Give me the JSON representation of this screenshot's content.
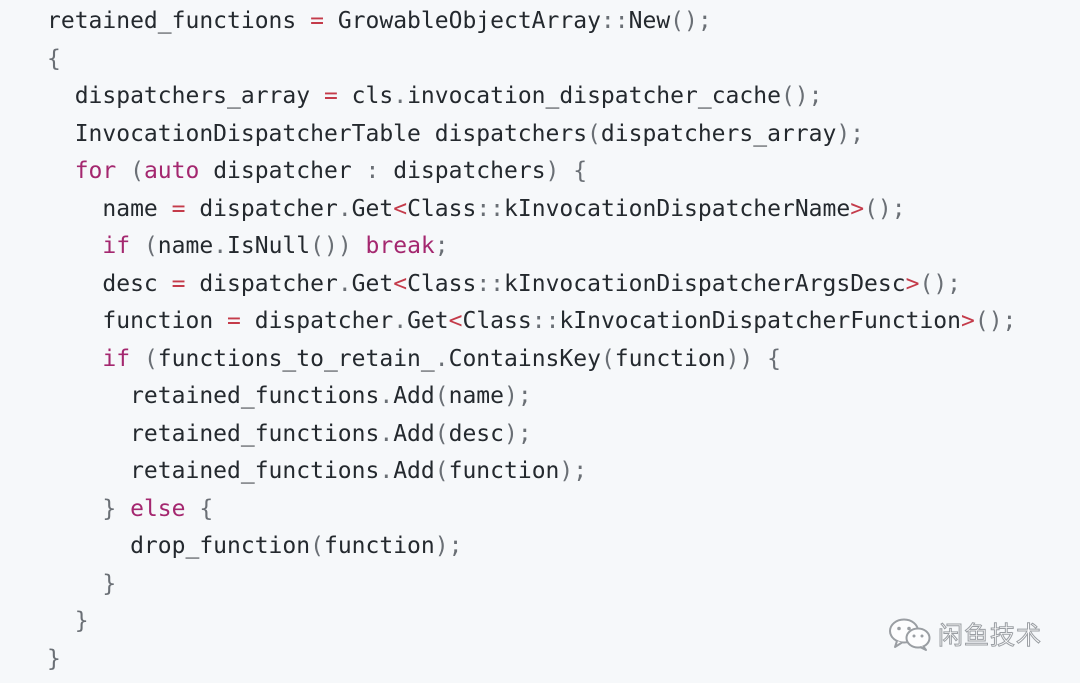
{
  "code_block": {
    "lines": [
      [
        {
          "t": "retained_functions ",
          "c": "plain"
        },
        {
          "t": "=",
          "c": "op"
        },
        {
          "t": " GrowableObjectArray",
          "c": "plain"
        },
        {
          "t": "::",
          "c": "punc"
        },
        {
          "t": "New",
          "c": "plain"
        },
        {
          "t": "();",
          "c": "punc"
        }
      ],
      [
        {
          "t": "{",
          "c": "punc"
        }
      ],
      [
        {
          "t": "  dispatchers_array ",
          "c": "plain"
        },
        {
          "t": "=",
          "c": "op"
        },
        {
          "t": " cls",
          "c": "plain"
        },
        {
          "t": ".",
          "c": "punc"
        },
        {
          "t": "invocation_dispatcher_cache",
          "c": "plain"
        },
        {
          "t": "();",
          "c": "punc"
        }
      ],
      [
        {
          "t": "  InvocationDispatcherTable dispatchers",
          "c": "plain"
        },
        {
          "t": "(",
          "c": "punc"
        },
        {
          "t": "dispatchers_array",
          "c": "plain"
        },
        {
          "t": ");",
          "c": "punc"
        }
      ],
      [
        {
          "t": "  ",
          "c": "plain"
        },
        {
          "t": "for",
          "c": "kw"
        },
        {
          "t": " (",
          "c": "punc"
        },
        {
          "t": "auto",
          "c": "kw"
        },
        {
          "t": " dispatcher ",
          "c": "plain"
        },
        {
          "t": ":",
          "c": "punc"
        },
        {
          "t": " dispatchers",
          "c": "plain"
        },
        {
          "t": ") {",
          "c": "punc"
        }
      ],
      [
        {
          "t": "    name ",
          "c": "plain"
        },
        {
          "t": "=",
          "c": "op"
        },
        {
          "t": " dispatcher",
          "c": "plain"
        },
        {
          "t": ".",
          "c": "punc"
        },
        {
          "t": "Get",
          "c": "plain"
        },
        {
          "t": "<",
          "c": "op"
        },
        {
          "t": "Class",
          "c": "plain"
        },
        {
          "t": "::",
          "c": "punc"
        },
        {
          "t": "kInvocationDispatcherName",
          "c": "plain"
        },
        {
          "t": ">",
          "c": "op"
        },
        {
          "t": "();",
          "c": "punc"
        }
      ],
      [
        {
          "t": "    ",
          "c": "plain"
        },
        {
          "t": "if",
          "c": "kw"
        },
        {
          "t": " (",
          "c": "punc"
        },
        {
          "t": "name",
          "c": "plain"
        },
        {
          "t": ".",
          "c": "punc"
        },
        {
          "t": "IsNull",
          "c": "plain"
        },
        {
          "t": "()) ",
          "c": "punc"
        },
        {
          "t": "break",
          "c": "kw"
        },
        {
          "t": ";",
          "c": "punc"
        }
      ],
      [
        {
          "t": "    desc ",
          "c": "plain"
        },
        {
          "t": "=",
          "c": "op"
        },
        {
          "t": " dispatcher",
          "c": "plain"
        },
        {
          "t": ".",
          "c": "punc"
        },
        {
          "t": "Get",
          "c": "plain"
        },
        {
          "t": "<",
          "c": "op"
        },
        {
          "t": "Class",
          "c": "plain"
        },
        {
          "t": "::",
          "c": "punc"
        },
        {
          "t": "kInvocationDispatcherArgsDesc",
          "c": "plain"
        },
        {
          "t": ">",
          "c": "op"
        },
        {
          "t": "();",
          "c": "punc"
        }
      ],
      [
        {
          "t": "    function ",
          "c": "plain"
        },
        {
          "t": "=",
          "c": "op"
        },
        {
          "t": " dispatcher",
          "c": "plain"
        },
        {
          "t": ".",
          "c": "punc"
        },
        {
          "t": "Get",
          "c": "plain"
        },
        {
          "t": "<",
          "c": "op"
        },
        {
          "t": "Class",
          "c": "plain"
        },
        {
          "t": "::",
          "c": "punc"
        },
        {
          "t": "kInvocationDispatcherFunction",
          "c": "plain"
        },
        {
          "t": ">",
          "c": "op"
        },
        {
          "t": "();",
          "c": "punc"
        }
      ],
      [
        {
          "t": "    ",
          "c": "plain"
        },
        {
          "t": "if",
          "c": "kw"
        },
        {
          "t": " (",
          "c": "punc"
        },
        {
          "t": "functions_to_retain_",
          "c": "plain"
        },
        {
          "t": ".",
          "c": "punc"
        },
        {
          "t": "ContainsKey",
          "c": "plain"
        },
        {
          "t": "(",
          "c": "punc"
        },
        {
          "t": "function",
          "c": "plain"
        },
        {
          "t": ")) {",
          "c": "punc"
        }
      ],
      [
        {
          "t": "      retained_functions",
          "c": "plain"
        },
        {
          "t": ".",
          "c": "punc"
        },
        {
          "t": "Add",
          "c": "plain"
        },
        {
          "t": "(",
          "c": "punc"
        },
        {
          "t": "name",
          "c": "plain"
        },
        {
          "t": ");",
          "c": "punc"
        }
      ],
      [
        {
          "t": "      retained_functions",
          "c": "plain"
        },
        {
          "t": ".",
          "c": "punc"
        },
        {
          "t": "Add",
          "c": "plain"
        },
        {
          "t": "(",
          "c": "punc"
        },
        {
          "t": "desc",
          "c": "plain"
        },
        {
          "t": ");",
          "c": "punc"
        }
      ],
      [
        {
          "t": "      retained_functions",
          "c": "plain"
        },
        {
          "t": ".",
          "c": "punc"
        },
        {
          "t": "Add",
          "c": "plain"
        },
        {
          "t": "(",
          "c": "punc"
        },
        {
          "t": "function",
          "c": "plain"
        },
        {
          "t": ");",
          "c": "punc"
        }
      ],
      [
        {
          "t": "    } ",
          "c": "punc"
        },
        {
          "t": "else",
          "c": "kw"
        },
        {
          "t": " {",
          "c": "punc"
        }
      ],
      [
        {
          "t": "      drop_function",
          "c": "plain"
        },
        {
          "t": "(",
          "c": "punc"
        },
        {
          "t": "function",
          "c": "plain"
        },
        {
          "t": ");",
          "c": "punc"
        }
      ],
      [
        {
          "t": "    }",
          "c": "punc"
        }
      ],
      [
        {
          "t": "  }",
          "c": "punc"
        }
      ],
      [
        {
          "t": "}",
          "c": "punc"
        }
      ]
    ]
  },
  "watermark": {
    "icon": "wechat-icon",
    "text": "闲鱼技术"
  },
  "colors": {
    "background": "#f6f8fa",
    "text": "#24292e",
    "keyword": "#a4276f",
    "operator": "#c43b4a",
    "punctuation": "#6a6f75"
  }
}
